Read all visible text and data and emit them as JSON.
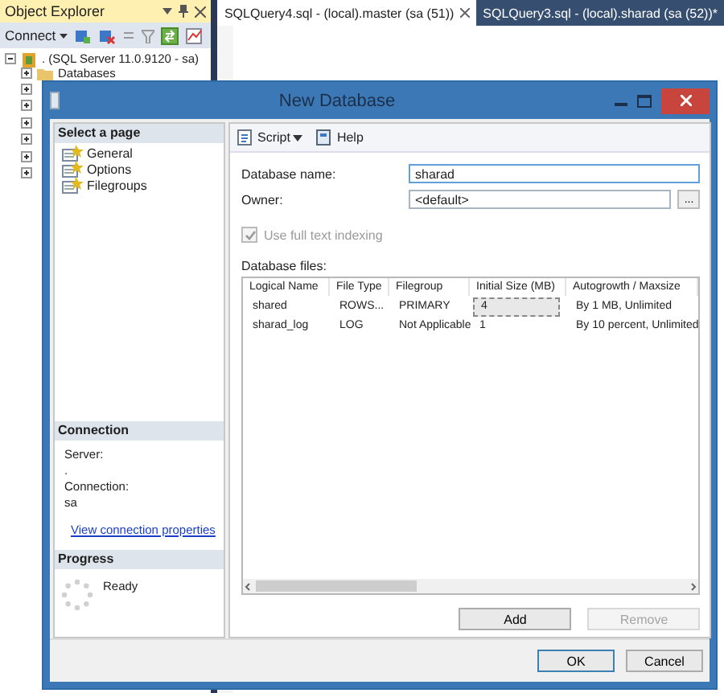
{
  "object_explorer": {
    "title": "Object Explorer",
    "connect": "Connect",
    "tree": [
      {
        "label": ". (SQL Server 11.0.9120 - sa)",
        "expanded": true,
        "children": [
          {
            "label": "Databases",
            "expanded": false
          },
          {
            "expanded": false
          },
          {
            "expanded": false
          },
          {
            "expanded": false
          },
          {
            "expanded": false
          },
          {
            "expanded": false
          },
          {
            "expanded": false
          }
        ]
      }
    ]
  },
  "tabs": [
    {
      "label": "SQLQuery4.sql - (local).master (sa (51))",
      "selected": true
    },
    {
      "label": "SQLQuery3.sql - (local).sharad (sa (52))*",
      "selected": false
    }
  ],
  "dialog": {
    "title": "New Database",
    "select_page": {
      "title": "Select a page",
      "pages": [
        {
          "label": "General"
        },
        {
          "label": "Options"
        },
        {
          "label": "Filegroups"
        }
      ]
    },
    "connection": {
      "title": "Connection",
      "server_label": "Server:",
      "server": ".",
      "connection_label": "Connection:",
      "connection": "sa",
      "link": "View connection properties"
    },
    "progress": {
      "title": "Progress",
      "status": "Ready"
    },
    "toolbar": {
      "script": "Script",
      "help": "Help"
    },
    "database_name": {
      "label": "Database name:",
      "value": "sharad"
    },
    "owner": {
      "label": "Owner:",
      "value": "<default>",
      "browse": "..."
    },
    "full_text": {
      "label": "Use full text indexing",
      "checked": true,
      "disabled": true
    },
    "files_label": "Database files:",
    "table": {
      "columns": [
        "Logical Name",
        "File Type",
        "Filegroup",
        "Initial Size (MB)",
        "Autogrowth / Maxsize"
      ],
      "rows": [
        {
          "cells": [
            "shared",
            "ROWS...",
            "PRIMARY",
            "4",
            "By 1 MB, Unlimited"
          ],
          "editing": true
        },
        {
          "cells": [
            "sharad_log",
            "LOG",
            "Not Applicable",
            "1",
            "By 10 percent, Unlimited"
          ],
          "editing": false
        }
      ]
    },
    "add": {
      "label": "Add",
      "disabled": false
    },
    "remove": {
      "label": "Remove",
      "disabled": true
    },
    "ok": "OK",
    "cancel": "Cancel"
  }
}
